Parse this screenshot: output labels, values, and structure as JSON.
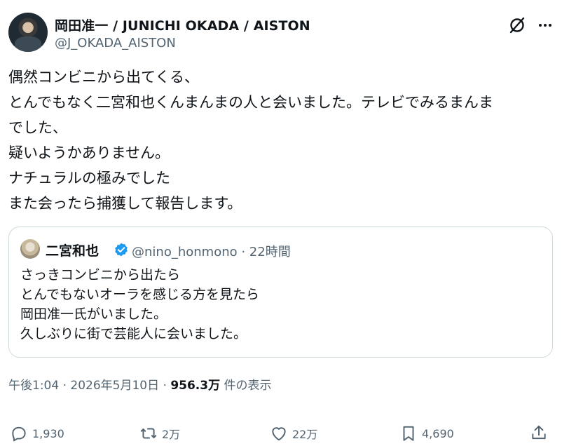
{
  "author": {
    "display_name": "岡田准一 / JUNICHI OKADA / AISTON",
    "handle": "@J_OKADA_AISTON"
  },
  "icons": {
    "grok": "grok-icon",
    "more": "more-icon",
    "reply": "reply-icon",
    "repost": "repost-icon",
    "like": "heart-icon",
    "bookmark": "bookmark-icon",
    "share": "share-icon",
    "verified": "verified-badge-icon"
  },
  "tweet": {
    "lines": [
      "偶然コンビニから出てくる、",
      "とんでもなく二宮和也くんまんまの人と会いました。テレビでみるまんま",
      "でした、",
      "疑いようかありません。",
      "ナチュラルの極みでした",
      "また会ったら捕獲して報告します。"
    ]
  },
  "quoted": {
    "name": "二宮和也",
    "meta": "@nino_honmono · 22時間",
    "lines": [
      "さっきコンビニから出たら",
      "とんでもないオーラを感じる方を見たら",
      "岡田准一氏がいました。",
      "久しぶりに街で芸能人に会いました。"
    ]
  },
  "timestamp": {
    "time": "午後1:04 · 2026年5月10日 · ",
    "views": "956.3万",
    "views_label": " 件の表示"
  },
  "stats": {
    "replies": "1,930",
    "reposts": "2万",
    "likes": "22万",
    "bookmarks": "4,690"
  },
  "colors": {
    "text": "#0f1419",
    "secondary": "#536471",
    "verified": "#1d9bf0",
    "border": "#cfd9de"
  }
}
